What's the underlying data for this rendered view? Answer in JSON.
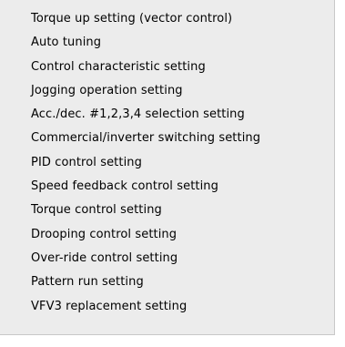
{
  "menu": {
    "items": [
      {
        "label": "Torque up setting (vector control)"
      },
      {
        "label": "Auto tuning"
      },
      {
        "label": "Control characteristic setting"
      },
      {
        "label": "Jogging operation setting"
      },
      {
        "label": "Acc./dec. #1,2,3,4 selection setting"
      },
      {
        "label": "Commercial/inverter switching setting"
      },
      {
        "label": "PID control setting"
      },
      {
        "label": "Speed feedback control setting"
      },
      {
        "label": "Torque control setting"
      },
      {
        "label": "Drooping control setting"
      },
      {
        "label": "Over-ride control setting"
      },
      {
        "label": "Pattern run setting"
      },
      {
        "label": "VFV3 replacement setting"
      }
    ]
  }
}
